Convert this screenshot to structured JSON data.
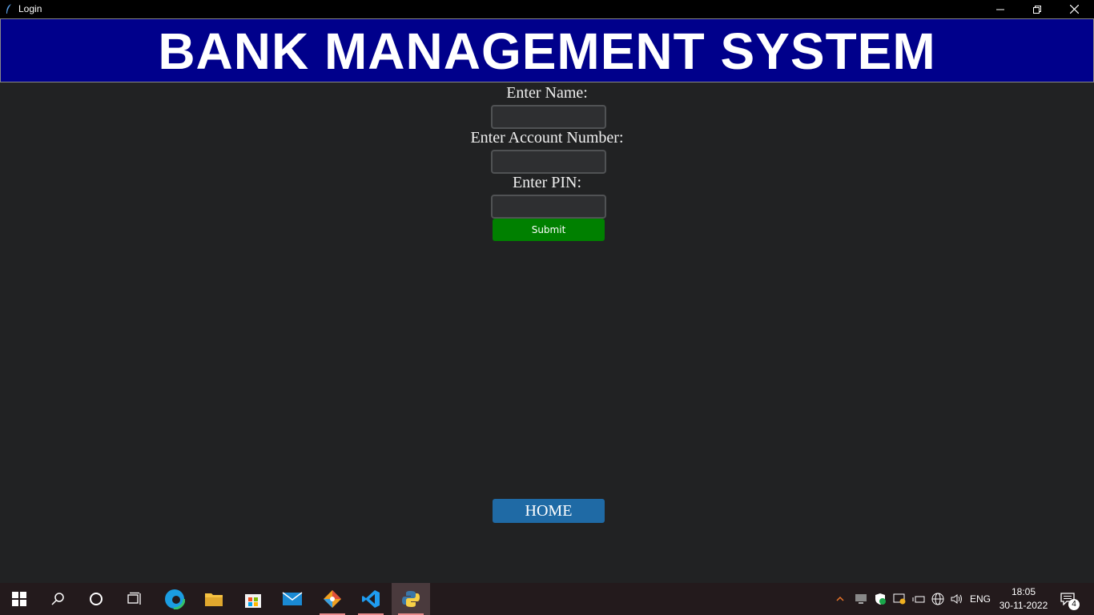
{
  "window": {
    "title": "Login",
    "controls": [
      "minimize",
      "restore",
      "close"
    ]
  },
  "banner": {
    "title": "BANK MANAGEMENT SYSTEM",
    "background": "#00008b"
  },
  "form": {
    "name_label": "Enter Name:",
    "name_value": "",
    "account_label": "Enter Account Number:",
    "account_value": "",
    "pin_label": "Enter PIN:",
    "pin_value": "",
    "submit_label": "Submit",
    "submit_color": "#008000"
  },
  "home_button": {
    "label": "HOME",
    "color": "#1f6aa5"
  },
  "taskbar": {
    "pinned": [
      "windows-start",
      "search",
      "cortana",
      "task-view",
      "edge",
      "file-explorer",
      "microsoft-store",
      "mail",
      "git",
      "vscode",
      "python"
    ],
    "tray": {
      "language": "ENG",
      "time": "18:05",
      "date": "30-11-2022",
      "notifications": "4"
    }
  }
}
